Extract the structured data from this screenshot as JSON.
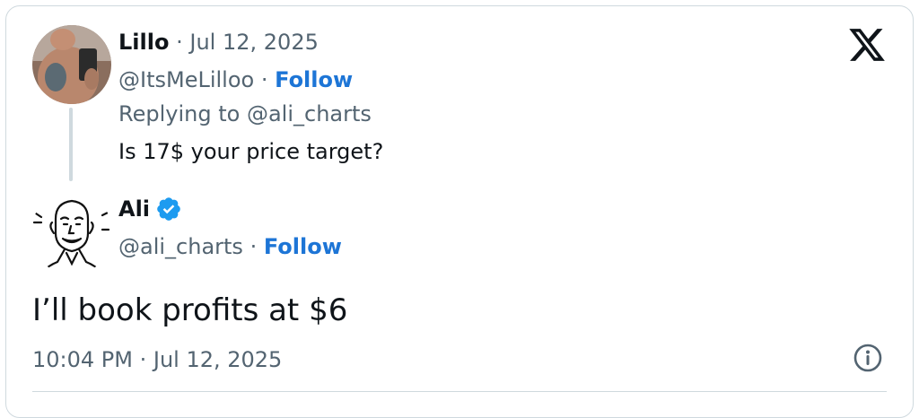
{
  "parent_tweet": {
    "author_name": "Lillo",
    "separator": "·",
    "date": "Jul 12, 2025",
    "handle": "@ItsMeLilloo",
    "follow_label": "Follow",
    "replying_prefix": "Replying to",
    "replying_to": "@ali_charts",
    "text": "Is 17$ your price target?",
    "avatar_icon": "user-photo-avatar"
  },
  "reply_tweet": {
    "author_name": "Ali",
    "verified_icon": "verified-badge-icon",
    "handle": "@ali_charts",
    "separator": "·",
    "follow_label": "Follow",
    "text": "I’ll book profits at $6",
    "timestamp": "10:04 PM · Jul 12, 2025",
    "avatar_icon": "cartoon-face-avatar"
  },
  "brand": {
    "logo_icon": "x-logo-icon"
  },
  "colors": {
    "follow": "#1d75d6",
    "link": "#1d9bf0",
    "muted": "#536471",
    "border": "#cfd9de",
    "verified": "#1d9bf0"
  }
}
